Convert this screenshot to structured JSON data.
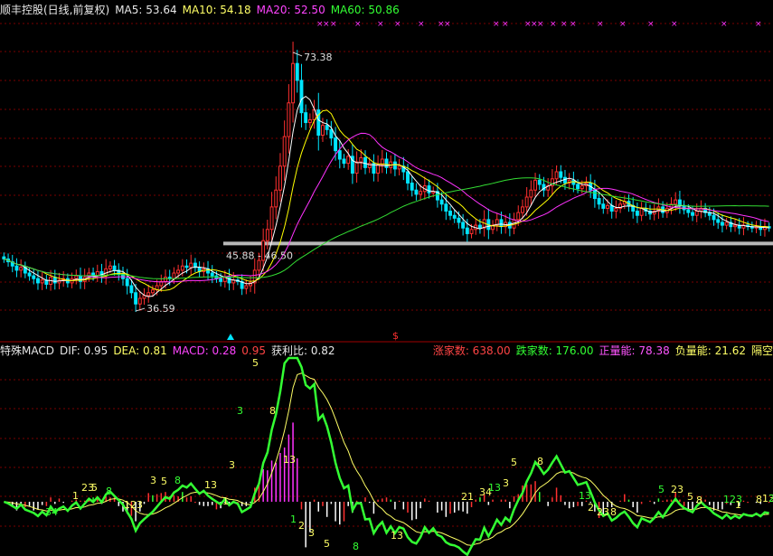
{
  "top_header": {
    "title": "顺丰控股(日线,前复权)",
    "ma5": "MA5: 53.64",
    "ma10": "MA10: 54.18",
    "ma20": "MA20: 52.50",
    "ma60": "MA60: 50.86"
  },
  "annotations": {
    "high": "73.38",
    "low": "36.59",
    "support": "45.88 - 46.50"
  },
  "bottom_header": {
    "indicator": "特殊MACD",
    "dif": "DIF: 0.95",
    "dea": "DEA: 0.81",
    "macd": "MACD: 0.28",
    "macd2": "0.95",
    "profit": "获利比: 0.82",
    "up_count": "涨家数: 638.00",
    "down_count": "跌家数: 176.00",
    "pos_energy": "正量能: 78.38",
    "neg_energy": "负量能: 21.62",
    "gap": "隔空"
  },
  "colors": {
    "up": "#ff3030",
    "down": "#00e5ff",
    "ma5": "#ffffff",
    "ma10": "#ffff00",
    "ma20": "#ff33ff",
    "ma60": "#33dd33",
    "grid": "#7a0000"
  },
  "chart_data": [
    {
      "type": "candlestick",
      "title": "顺丰控股(日线,前复权)",
      "ylim": [
        33,
        78
      ],
      "annotations": [
        {
          "label": "73.38",
          "bar": 68,
          "value": 73.38
        },
        {
          "label": "36.59",
          "bar": 31,
          "value": 36.59
        },
        {
          "label": "45.88 - 46.50",
          "value": 46.2
        }
      ],
      "series_closes": [
        44,
        43.6,
        43,
        42.4,
        42.8,
        42,
        41.6,
        41.2,
        40.6,
        41,
        40.4,
        41.4,
        40.6,
        41,
        41.2,
        40.6,
        41.2,
        41.6,
        40.8,
        41.4,
        42,
        41.6,
        42.2,
        41.6,
        42.6,
        43,
        42.4,
        41.8,
        41.2,
        40.2,
        39.2,
        37.6,
        38.4,
        38.8,
        39.2,
        39.6,
        40.2,
        40.8,
        41.4,
        41.2,
        42,
        42.4,
        43,
        42.8,
        43.4,
        42.8,
        42.2,
        42.6,
        42,
        41.6,
        41.2,
        40.8,
        41.4,
        40.6,
        41,
        40.8,
        39.8,
        40.2,
        40.6,
        42.4,
        43.8,
        46.6,
        48.2,
        51.4,
        53.8,
        57.2,
        61.4,
        66.2,
        71.8,
        69.4,
        64.8,
        63.4,
        63.8,
        65.2,
        61.6,
        63,
        62.4,
        61.2,
        59.4,
        58.2,
        57.6,
        58.6,
        56.2,
        57.8,
        58.4,
        57,
        57.6,
        56.2,
        57.4,
        58.2,
        57,
        57.8,
        56.8,
        57.2,
        56.4,
        54.8,
        53.8,
        53.2,
        53.6,
        54.4,
        53.4,
        53.6,
        52.4,
        51.8,
        50.8,
        50.2,
        49.8,
        49.2,
        48.4,
        47.6,
        48.2,
        48.8,
        48.4,
        49.6,
        48.2,
        48.8,
        49.6,
        48.6,
        49.2,
        48.4,
        49.6,
        50.6,
        51.4,
        52.8,
        53.8,
        55.2,
        54.6,
        53.8,
        54.4,
        55.4,
        56.4,
        55.6,
        54.8,
        55.2,
        54.6,
        54,
        54.4,
        54.8,
        53.8,
        52.6,
        51.8,
        51.2,
        51.6,
        50.8,
        51.2,
        51.8,
        52.2,
        51.6,
        50.8,
        50.2,
        51.2,
        50.8,
        50.4,
        50.8,
        51.4,
        50.6,
        51.2,
        51.8,
        52.4,
        51.6,
        51,
        50.6,
        50.2,
        50.8,
        51.2,
        50.6,
        50.2,
        49.6,
        49.2,
        48.8,
        49.2,
        48.6,
        48.8,
        48.4,
        48.8,
        48.6,
        48.4,
        48.6,
        48.2,
        48.6,
        48.4
      ],
      "ma5": 53.64,
      "ma10": 54.18,
      "ma20": 52.5,
      "ma60": 50.86
    },
    {
      "type": "macd",
      "title": "特殊MACD",
      "dif": 0.95,
      "dea": 0.81,
      "macd": 0.28,
      "labels": [
        "34",
        "1",
        "23",
        "5",
        "8",
        "123",
        "3",
        "5",
        "8",
        "13",
        "1",
        "3",
        "3",
        "5",
        "8",
        "13",
        "1",
        "2",
        "3",
        "5",
        "8",
        "13",
        "21",
        "34",
        "13",
        "3",
        "5",
        "8",
        "13",
        "2",
        "23",
        "8",
        "5",
        "23",
        "5",
        "8",
        "123",
        "1",
        "8",
        "13",
        "21"
      ]
    }
  ]
}
